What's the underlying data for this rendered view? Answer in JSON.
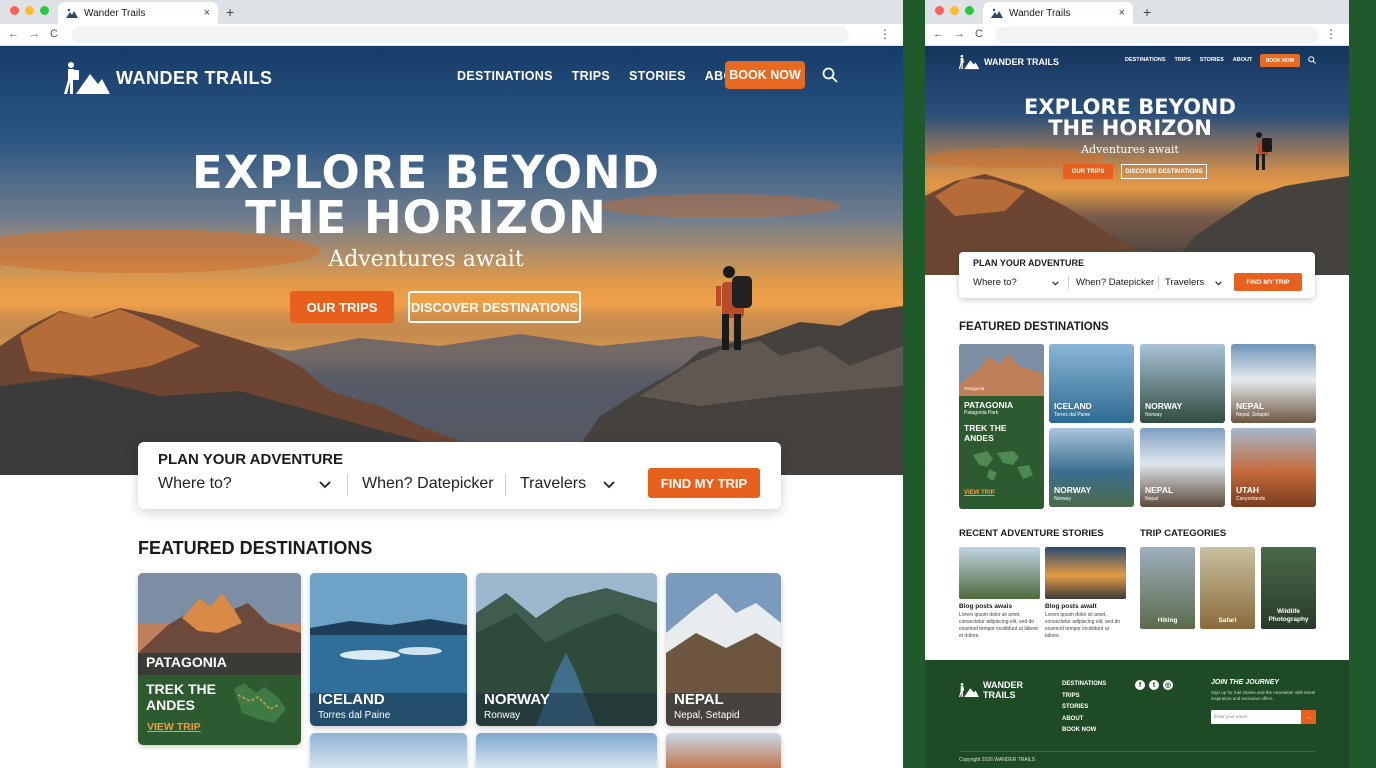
{
  "browser": {
    "tab_title": "Wander Trails",
    "close": "×",
    "new_tab": "+",
    "back": "←",
    "forward": "→",
    "reload": "C",
    "menu": "⋮"
  },
  "site": {
    "logo_text": "WANDER TRAILS",
    "nav": [
      "DESTINATIONS",
      "TRIPS",
      "STORIES",
      "ABOUT"
    ],
    "book_now": "BOOK NOW",
    "hero_title_line1": "EXPLORE BEYOND",
    "hero_title_line2": "THE HORIZON",
    "hero_subtitle": "Adventures await",
    "btn_trips": "OUR TRIPS",
    "btn_discover": "DISCOVER DESTINATIONS",
    "plan_title": "PLAN YOUR ADVENTURE",
    "plan_where": "Where to?",
    "plan_when": "When? Datepicker",
    "plan_travelers": "Travelers",
    "find_trip": "FIND MY TRIP",
    "featured_heading": "FEATURED DESTINATIONS",
    "cards": [
      {
        "name": "PATAGONIA",
        "title": "TREK THE ANDES",
        "title_line1": "TREK THE",
        "title_line2": "ANDES",
        "link": "VIEW TRIP"
      },
      {
        "name": "ICELAND",
        "location": "Torres dal Paine"
      },
      {
        "name": "NORWAY",
        "location": "Ronway"
      },
      {
        "name": "NEPAL",
        "location": "Nepal, Setapid"
      }
    ]
  },
  "mobile": {
    "logo_text": "WANDER TRAILS",
    "nav": [
      "DESTINATIONS",
      "TRIPS",
      "STORIES",
      "ABOUT"
    ],
    "book_now": "BOOK NOW",
    "hero_title_line1": "EXPLORE BEYOND",
    "hero_title_line2": "THE HORIZON",
    "hero_subtitle": "Adventures await",
    "btn_trips": "OUR TRIPS",
    "btn_discover": "DISCOVER DESTINATIONS",
    "plan_title": "PLAN YOUR ADVENTURE",
    "plan_where": "Where to?",
    "plan_when": "When? Datepicker",
    "plan_travelers": "Travelers",
    "find_trip": "FIND MY TRIP",
    "featured_heading": "FEATURED DESTINATIONS",
    "patagonia": {
      "kicker": "Patagonia",
      "name": "PATAGONIA",
      "location": "Patagonia Park",
      "title_line1": "TREK THE",
      "title_line2": "ANDES",
      "link": "VIEW TRIP"
    },
    "cards": [
      {
        "name": "ICELAND",
        "location": "Torres dal Paine"
      },
      {
        "name": "NORWAY",
        "location": "Norway"
      },
      {
        "name": "NEPAL",
        "location": "Nepal, Setapid"
      },
      {
        "name": "NORWAY",
        "location": "Norway"
      },
      {
        "name": "NEPAL",
        "location": "Nepal"
      },
      {
        "name": "UTAH",
        "location": "Canyonlands"
      }
    ],
    "stories_heading": "RECENT ADVENTURE STORIES",
    "stories": [
      {
        "title": "Blog posts awais",
        "body": "Lorem ipsum dolor sit amet, consectetur adipiscing elit, sed do eiusmod tempor incididunt ut labore et dolore."
      },
      {
        "title": "Blog posts awalt",
        "body": "Lorem ipsum dolor sit amet, consectetur adipiscing elit, sed do eiusmod tempor incididunt ut labore."
      }
    ],
    "categories_heading": "TRIP CATEGORIES",
    "categories": [
      "Hiking",
      "Safari",
      "Wildlife Photography"
    ],
    "footer": {
      "logo_line1": "WANDER",
      "logo_line2": "TRAILS",
      "links": [
        "DESTINATIONS",
        "TRIPS",
        "STORIES",
        "ABOUT",
        "BOOK NOW"
      ],
      "join_title": "JOIN THE JOURNEY",
      "join_text": "Sign up for trail stories and the newsletter with travel inspiration and exclusive offers.",
      "email_placeholder": "Enter your email",
      "submit": "→",
      "copyright": "Copyright 2026 WANDER TRAILS"
    }
  }
}
